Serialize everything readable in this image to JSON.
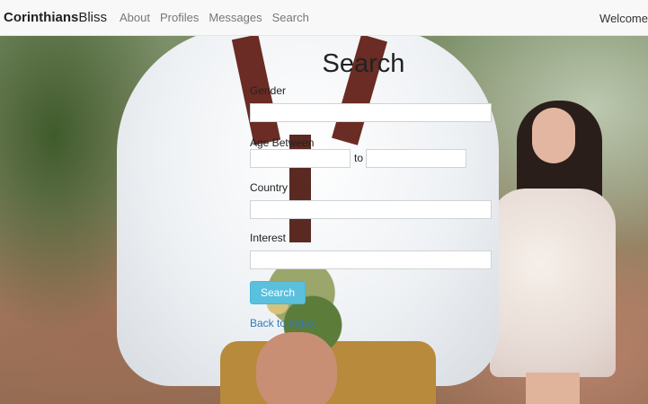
{
  "navbar": {
    "brand_bold": "Corinthians",
    "brand_light": "Bliss",
    "links": [
      "About",
      "Profiles",
      "Messages",
      "Search"
    ],
    "welcome": "Welcome"
  },
  "form": {
    "title": "Search",
    "gender_label": "Gender",
    "gender_value": "",
    "age_label": "Age Between",
    "age_from_value": "",
    "age_to_label": "to",
    "age_to_value": "",
    "country_label": "Country",
    "country_value": "",
    "interest_label": "Interest",
    "interest_value": "",
    "submit_label": "Search",
    "back_link": "Back to Index"
  },
  "colors": {
    "button": "#5bc0de",
    "link": "#337ab7",
    "navbar_bg": "#f8f8f8"
  }
}
